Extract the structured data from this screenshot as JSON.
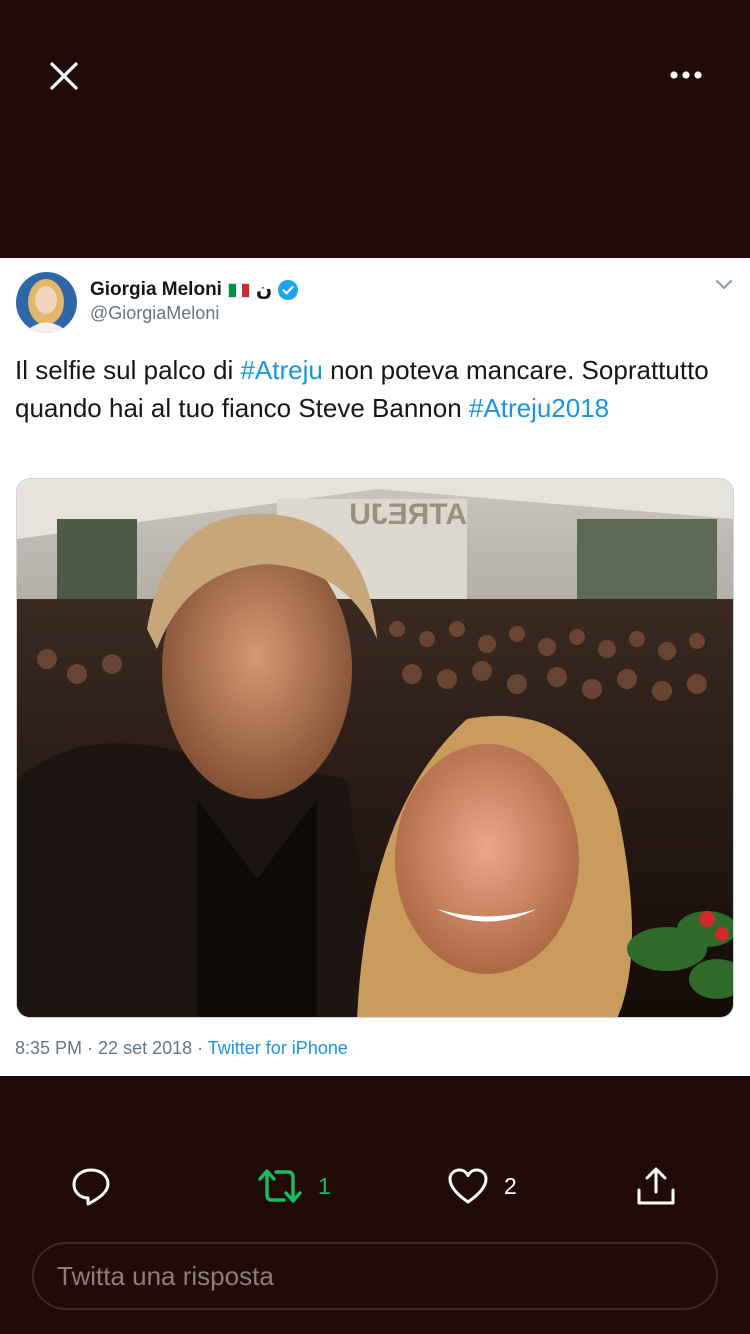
{
  "colors": {
    "background": "#200b09",
    "text": "#14171a",
    "secondary_text": "#657786",
    "link": "#1b95e0",
    "retweet_active": "#17bf63",
    "verified": "#1da1f2"
  },
  "toolbar": {
    "close_icon": "close-icon",
    "more_icon": "more-dots-icon"
  },
  "tweet": {
    "author_name": "Giorgia Meloni",
    "author_flag": "italy-flag-icon",
    "author_name_suffix": "ن",
    "verified_icon": "verified-badge-icon",
    "handle": "@GiorgiaMeloni",
    "text_part1": "Il selfie sul palco di ",
    "hashtag1": "#Atreju",
    "text_part2": " non poteva mancare. Soprattutto quando hai al tuo fianco Steve Bannon ",
    "hashtag2": "#Atreju2018",
    "media_sign_text": "ATREJU",
    "time": "8:35 PM",
    "separator1": " · ",
    "date": "22 set 2018",
    "separator2": " · ",
    "source": "Twitter for iPhone"
  },
  "actions": {
    "reply_icon": "reply-icon",
    "retweet_icon": "retweet-icon",
    "retweet_count": "1",
    "like_icon": "heart-icon",
    "like_count": "2",
    "share_icon": "share-icon"
  },
  "reply_box": {
    "placeholder": "Twitta una risposta"
  }
}
